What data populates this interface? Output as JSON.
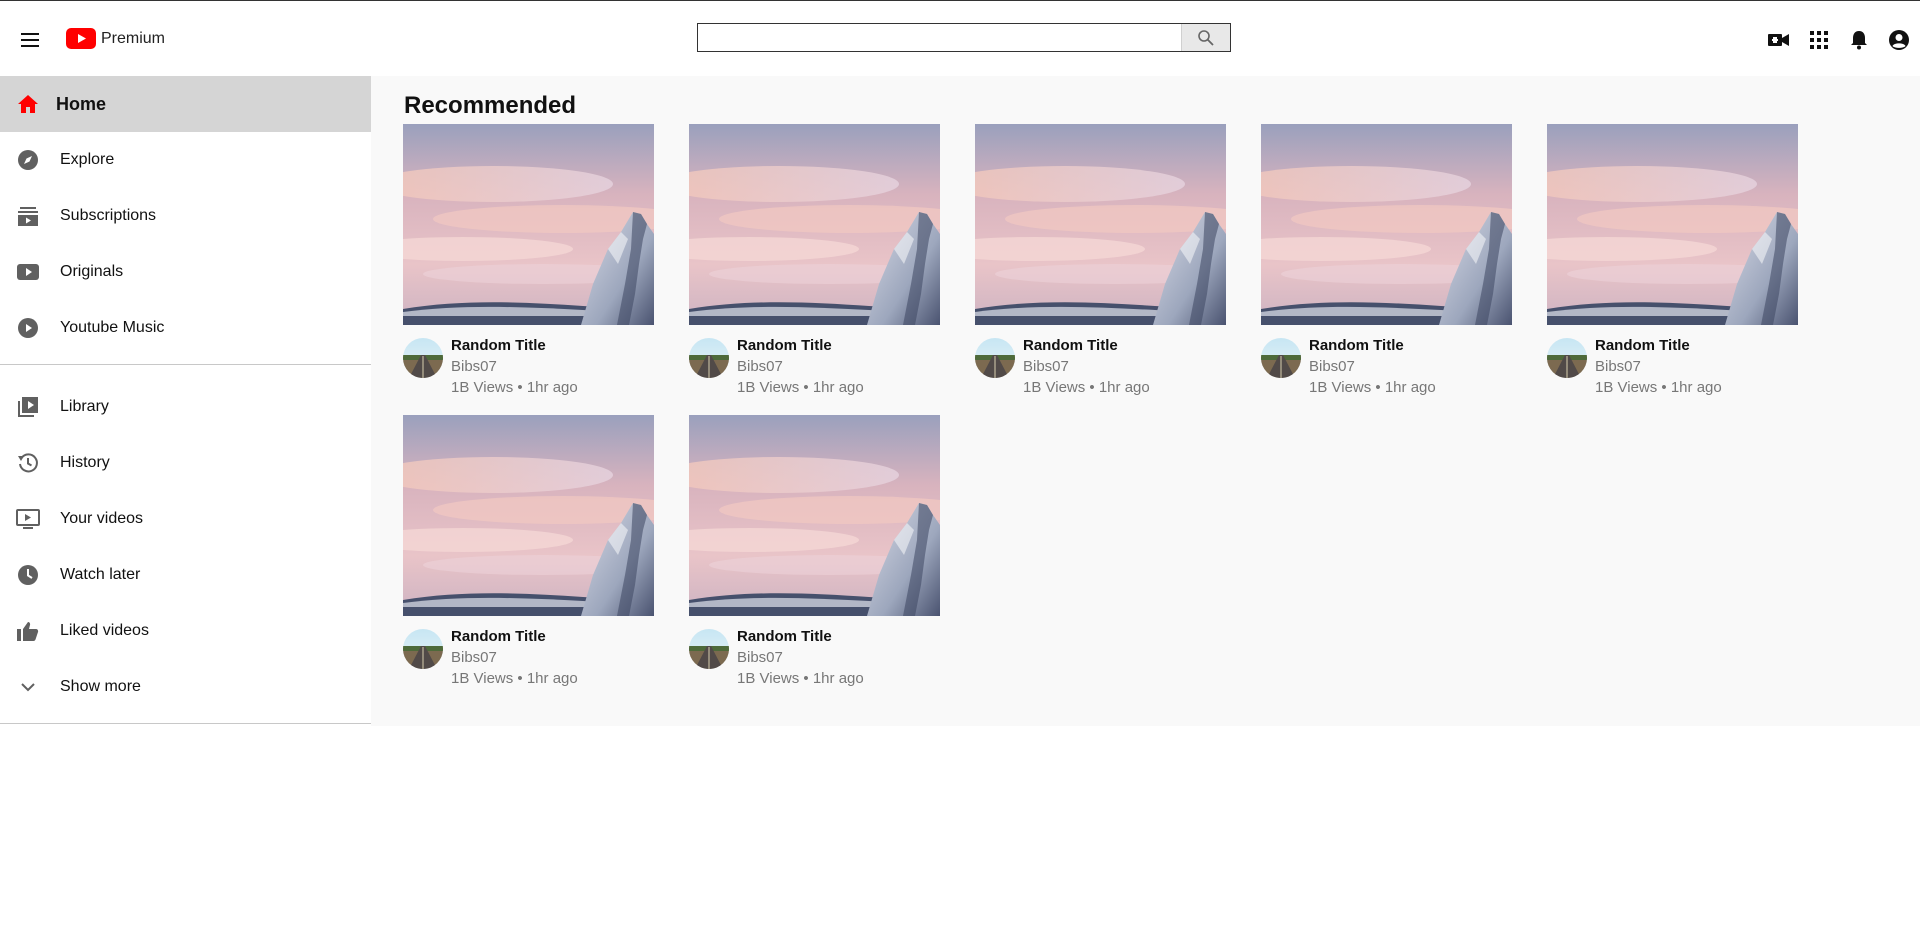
{
  "app": {
    "logo_text": "Premium",
    "brand_color": "#ff0000"
  },
  "search": {
    "value": "",
    "placeholder": ""
  },
  "header_icons": [
    "video-camera-icon",
    "apps-grid-icon",
    "notification-bell-icon",
    "account-icon"
  ],
  "sidebar": {
    "primary": [
      {
        "label": "Home",
        "icon": "home-icon",
        "active": true
      },
      {
        "label": "Explore",
        "icon": "compass-icon"
      },
      {
        "label": "Subscriptions",
        "icon": "subscriptions-icon"
      },
      {
        "label": "Originals",
        "icon": "originals-icon"
      },
      {
        "label": "Youtube Music",
        "icon": "music-play-icon"
      }
    ],
    "secondary": [
      {
        "label": "Library",
        "icon": "library-icon"
      },
      {
        "label": "History",
        "icon": "history-icon"
      },
      {
        "label": "Your videos",
        "icon": "your-videos-icon"
      },
      {
        "label": "Watch later",
        "icon": "clock-icon"
      },
      {
        "label": "Liked videos",
        "icon": "thumbs-up-icon"
      },
      {
        "label": "Show more",
        "icon": "chevron-down-icon"
      }
    ]
  },
  "main": {
    "title": "Recommended",
    "videos": [
      {
        "title": "Random Title",
        "channel": "Bibs07",
        "stats": "1B Views • 1hr ago"
      },
      {
        "title": "Random Title",
        "channel": "Bibs07",
        "stats": "1B Views • 1hr ago"
      },
      {
        "title": "Random Title",
        "channel": "Bibs07",
        "stats": "1B Views • 1hr ago"
      },
      {
        "title": "Random Title",
        "channel": "Bibs07",
        "stats": "1B Views • 1hr ago"
      },
      {
        "title": "Random Title",
        "channel": "Bibs07",
        "stats": "1B Views • 1hr ago"
      },
      {
        "title": "Random Title",
        "channel": "Bibs07",
        "stats": "1B Views • 1hr ago"
      },
      {
        "title": "Random Title",
        "channel": "Bibs07",
        "stats": "1B Views • 1hr ago"
      }
    ]
  }
}
